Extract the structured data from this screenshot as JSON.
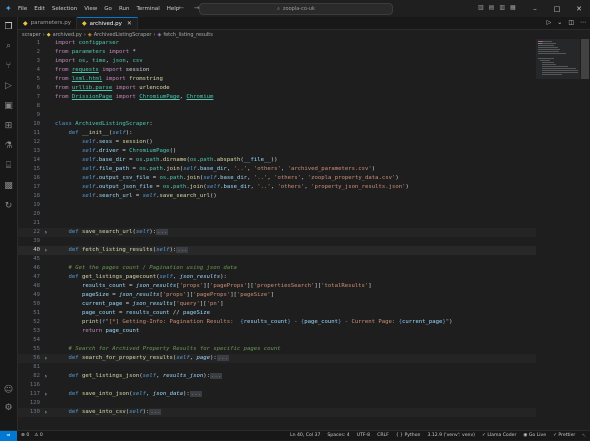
{
  "menu": [
    "File",
    "Edit",
    "Selection",
    "View",
    "Go",
    "Run",
    "Terminal",
    "Help"
  ],
  "search": "zoopla-co-uk",
  "tabs": [
    {
      "label": "parameters.py",
      "active": false
    },
    {
      "label": "archived.py",
      "active": true
    }
  ],
  "breadcrumb": [
    "scraper",
    "archived.py",
    "ArchivedListingScraper",
    "fetch_listing_results"
  ],
  "lines": [
    {
      "n": "1",
      "html": "<span class='k'>import</span> <span class='mod'>configparser</span>"
    },
    {
      "n": "2",
      "html": "<span class='k'>from</span> <span class='mod'>parameters</span> <span class='k'>import</span> <span class='plain'>*</span>"
    },
    {
      "n": "3",
      "html": "<span class='k'>import</span> <span class='mod'>os</span><span class='plain'>, </span><span class='mod'>time</span><span class='plain'>, </span><span class='mod'>json</span><span class='plain'>, </span><span class='mod'>csv</span>"
    },
    {
      "n": "4",
      "html": "<span class='k'>from</span> <span class='mod und'>requests</span> <span class='k'>import</span> <span class='plain'>session</span>"
    },
    {
      "n": "5",
      "html": "<span class='k'>from</span> <span class='mod und'>lxml.html</span> <span class='k'>import</span> <span class='fnn'>fromstring</span>"
    },
    {
      "n": "6",
      "html": "<span class='k'>from</span> <span class='mod und'>urllib.parse</span> <span class='k'>import</span> <span class='fnn'>urlencode</span>"
    },
    {
      "n": "7",
      "html": "<span class='k'>from</span> <span class='mod und'>DrissionPage</span> <span class='k'>import</span> <span class='cls und'>ChromiumPage</span><span class='plain'>, </span><span class='cls und'>Chromium</span>"
    },
    {
      "n": "8",
      "html": ""
    },
    {
      "n": "9",
      "html": ""
    },
    {
      "n": "10",
      "html": "<span class='kb'>class</span> <span class='cls'>ArchivedListingScraper</span><span class='plain'>:</span>"
    },
    {
      "n": "11",
      "html": "    <span class='kb'>def</span> <span class='fnn'>__init__</span><span class='plain'>(</span><span class='slf'>self</span><span class='plain'>):</span>"
    },
    {
      "n": "12",
      "html": "        <span class='slf'>self</span><span class='plain'>.</span><span class='var'>sess</span><span class='plain'> = </span><span class='fnn'>session</span><span class='plain'>()</span>"
    },
    {
      "n": "13",
      "html": "        <span class='slf'>self</span><span class='plain'>.</span><span class='var'>driver</span><span class='plain'> = </span><span class='cls'>ChromiumPage</span><span class='plain'>()</span>"
    },
    {
      "n": "14",
      "html": "        <span class='slf'>self</span><span class='plain'>.</span><span class='var'>base_dir</span><span class='plain'> = </span><span class='mod'>os</span><span class='plain'>.</span><span class='mod'>path</span><span class='plain'>.</span><span class='fnn'>dirname</span><span class='plain'>(</span><span class='mod'>os</span><span class='plain'>.</span><span class='mod'>path</span><span class='plain'>.</span><span class='fnn'>abspath</span><span class='plain'>(</span><span class='var'>__file__</span><span class='plain'>))</span>"
    },
    {
      "n": "15",
      "html": "        <span class='slf'>self</span><span class='plain'>.</span><span class='var'>file_path</span><span class='plain'> = </span><span class='mod'>os</span><span class='plain'>.</span><span class='mod'>path</span><span class='plain'>.</span><span class='fnn'>join</span><span class='plain'>(</span><span class='slf'>self</span><span class='plain'>.</span><span class='var'>base_dir</span><span class='plain'>, </span><span class='str'>'..'</span><span class='plain'>, </span><span class='str'>'others'</span><span class='plain'>, </span><span class='str'>'archived_parameters.csv'</span><span class='plain'>)</span>"
    },
    {
      "n": "16",
      "html": "        <span class='slf'>self</span><span class='plain'>.</span><span class='var'>output_csv_file</span><span class='plain'> = </span><span class='mod'>os</span><span class='plain'>.</span><span class='mod'>path</span><span class='plain'>.</span><span class='fnn'>join</span><span class='plain'>(</span><span class='slf'>self</span><span class='plain'>.</span><span class='var'>base_dir</span><span class='plain'>, </span><span class='str'>'..'</span><span class='plain'>, </span><span class='str'>'others'</span><span class='plain'>, </span><span class='str'>'zoopla_property_data.csv'</span><span class='plain'>)</span>"
    },
    {
      "n": "17",
      "html": "        <span class='slf'>self</span><span class='plain'>.</span><span class='var'>output_json_file</span><span class='plain'> = </span><span class='mod'>os</span><span class='plain'>.</span><span class='mod'>path</span><span class='plain'>.</span><span class='fnn'>join</span><span class='plain'>(</span><span class='slf'>self</span><span class='plain'>.</span><span class='var'>base_dir</span><span class='plain'>, </span><span class='str'>'..'</span><span class='plain'>, </span><span class='str'>'others'</span><span class='plain'>, </span><span class='str'>'property_json_results.json'</span><span class='plain'>)</span>"
    },
    {
      "n": "18",
      "html": "        <span class='slf'>self</span><span class='plain'>.</span><span class='var'>search_url</span><span class='plain'> = </span><span class='slf'>self</span><span class='plain'>.</span><span class='fnn'>save_search_url</span><span class='plain'>()</span>"
    },
    {
      "n": "19",
      "html": ""
    },
    {
      "n": "20",
      "html": ""
    },
    {
      "n": "21",
      "html": ""
    },
    {
      "n": "22",
      "html": "    <span class='kb'>def</span> <span class='fnn'>save_search_url</span><span class='plain'>(</span><span class='slf'>self</span><span class='plain'>):</span><span class='ell'>...</span>",
      "fold": true,
      "hl": true
    },
    {
      "n": "39",
      "html": ""
    },
    {
      "n": "40",
      "html": "    <span class='kb'>def</span> <span class='fnn'>fetch_listing_results</span><span class='plain'>(</span><span class='slf'>self</span><span class='plain'>):</span><span class='ell'>...</span>",
      "fold": true,
      "cur": true
    },
    {
      "n": "45",
      "html": ""
    },
    {
      "n": "46",
      "html": "    <span class='com'># Get the pages count / Pagination using json data</span>"
    },
    {
      "n": "47",
      "html": "    <span class='kb'>def</span> <span class='fnn'>get_listings_pagecount</span><span class='plain'>(</span><span class='slf'>self</span><span class='plain'>, </span><span class='prm'>json_results</span><span class='plain'>):</span>"
    },
    {
      "n": "48",
      "html": "        <span class='var'>results_count</span><span class='plain'> = </span><span class='prm'>json_results</span><span class='plain'>[</span><span class='str'>'props'</span><span class='plain'>][</span><span class='str'>'pageProps'</span><span class='plain'>][</span><span class='str'>'propertiesSearch'</span><span class='plain'>][</span><span class='str'>'totalResults'</span><span class='plain'>]</span>"
    },
    {
      "n": "49",
      "html": "        <span class='var'>pageSize</span><span class='plain'> = </span><span class='prm'>json_results</span><span class='plain'>[</span><span class='str'>'props'</span><span class='plain'>][</span><span class='str'>'pageProps'</span><span class='plain'>][</span><span class='str'>'pageSize'</span><span class='plain'>]</span>"
    },
    {
      "n": "50",
      "html": "        <span class='var'>current_page</span><span class='plain'> = </span><span class='prm'>json_results</span><span class='plain'>[</span><span class='str'>'query'</span><span class='plain'>][</span><span class='str'>'pn'</span><span class='plain'>]</span>"
    },
    {
      "n": "51",
      "html": "        <span class='var'>page_count</span><span class='plain'> = </span><span class='var'>results_count</span><span class='plain'> // </span><span class='var'>pageSize</span>"
    },
    {
      "n": "52",
      "html": "        <span class='fnn'>print</span><span class='plain'>(</span><span class='kb'>f</span><span class='str'>\"[*] Getting-Info: Pagination Results:  </span><span class='kb'>{</span><span class='var'>results_count</span><span class='kb'>}</span><span class='str'> - </span><span class='kb'>{</span><span class='var'>page_count</span><span class='kb'>}</span><span class='str'> - Current Page: </span><span class='kb'>{</span><span class='var'>current_page</span><span class='kb'>}</span><span class='str'>\"</span><span class='plain'>)</span>"
    },
    {
      "n": "53",
      "html": "        <span class='k'>return</span> <span class='var'>page_count</span>"
    },
    {
      "n": "54",
      "html": ""
    },
    {
      "n": "55",
      "html": "    <span class='com'># Search for Archived Property Results for specific pages count</span>"
    },
    {
      "n": "56",
      "html": "    <span class='kb'>def</span> <span class='fnn'>search_for_property_results</span><span class='plain'>(</span><span class='slf'>self</span><span class='plain'>, </span><span class='prm'>page</span><span class='plain'>):</span><span class='ell'>...</span>",
      "fold": true,
      "hl": true
    },
    {
      "n": "81",
      "html": ""
    },
    {
      "n": "82",
      "html": "    <span class='kb'>def</span> <span class='fnn'>get_listings_json</span><span class='plain'>(</span><span class='slf'>self</span><span class='plain'>, </span><span class='prm'>results_json</span><span class='plain'>):</span><span class='ell'>...</span>",
      "fold": true
    },
    {
      "n": "116",
      "html": ""
    },
    {
      "n": "117",
      "html": "    <span class='kb'>def</span> <span class='fnn'>save_into_json</span><span class='plain'>(</span><span class='slf'>self</span><span class='plain'>, </span><span class='prm'>json_data</span><span class='plain'>):</span><span class='ell'>...</span>",
      "fold": true
    },
    {
      "n": "129",
      "html": ""
    },
    {
      "n": "130",
      "html": "    <span class='kb'>def</span> <span class='fnn'>save_into_csv</span><span class='plain'>(</span><span class='slf'>self</span><span class='plain'>):</span><span class='ell'>...</span>",
      "fold": true,
      "hl": true
    }
  ],
  "status": {
    "left": [
      "0",
      "0"
    ],
    "position": "Ln 40, Col 37",
    "spaces": "Spaces: 4",
    "encoding": "UTF-8",
    "eol": "CRLF",
    "language": "Python",
    "interpreter": "3.12.9 ('venv': venv)",
    "llama": "Llama Coder",
    "golive": "Go Live",
    "prettier": "Prettier"
  },
  "colors": {
    "accent": "#0078d4",
    "bg": "#1e1e1e",
    "sidebar": "#181818"
  }
}
